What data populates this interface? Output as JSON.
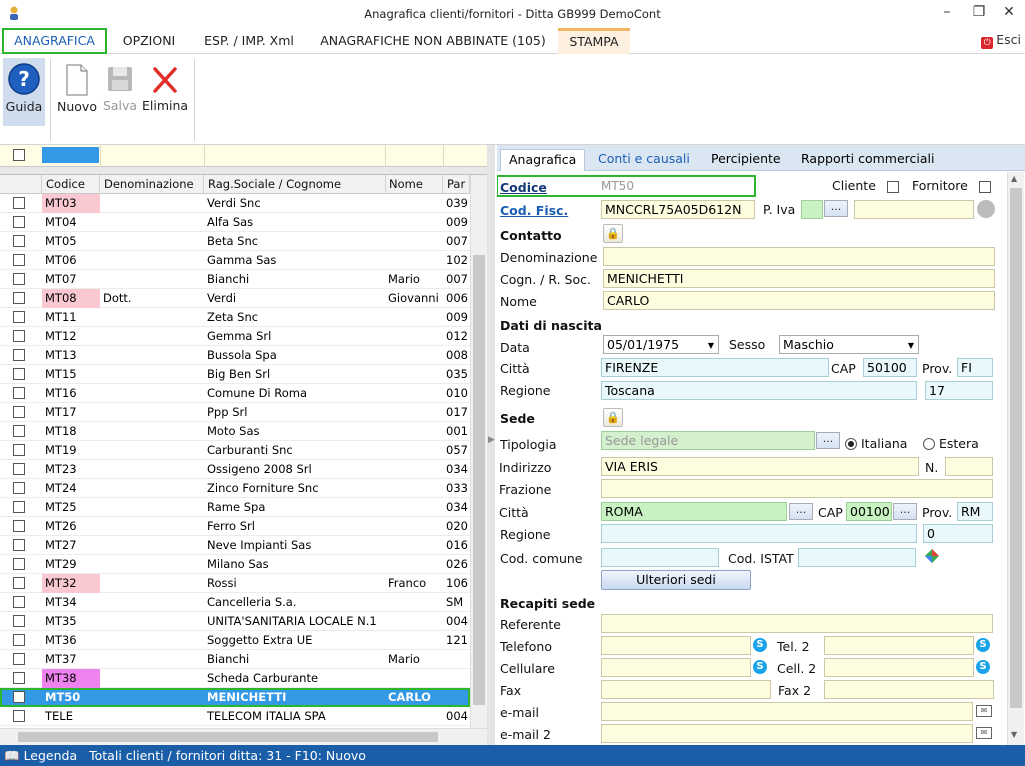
{
  "window": {
    "title": "Anagrafica clienti/fornitori - Ditta GB999 DemoCont"
  },
  "menu": {
    "tabs": [
      "ANAGRAFICA",
      "OPZIONI",
      "ESP. / IMP. Xml",
      "ANAGRAFICHE NON ABBINATE (105)",
      "STAMPA"
    ],
    "exit": "Esci"
  },
  "ribbon": {
    "guida": "Guida",
    "nuovo": "Nuovo",
    "salva": "Salva",
    "elimina": "Elimina"
  },
  "grid": {
    "headers": [
      "Codice",
      "Denominazione",
      "Rag.Sociale / Cognome",
      "Nome",
      "Par"
    ],
    "rows": [
      {
        "code": "MT03",
        "den": "",
        "rag": "Verdi Snc",
        "nome": "",
        "par": "039",
        "color": "#f9c8d0"
      },
      {
        "code": "MT04",
        "den": "",
        "rag": "Alfa Sas",
        "nome": "",
        "par": "009",
        "color": ""
      },
      {
        "code": "MT05",
        "den": "",
        "rag": "Beta Snc",
        "nome": "",
        "par": "007",
        "color": ""
      },
      {
        "code": "MT06",
        "den": "",
        "rag": "Gamma Sas",
        "nome": "",
        "par": "102",
        "color": ""
      },
      {
        "code": "MT07",
        "den": "",
        "rag": "Bianchi",
        "nome": "Mario",
        "par": "007",
        "color": ""
      },
      {
        "code": "MT08",
        "den": "Dott.",
        "rag": "Verdi",
        "nome": "Giovanni",
        "par": "006",
        "color": "#f9c8d0"
      },
      {
        "code": "MT11",
        "den": "",
        "rag": "Zeta Snc",
        "nome": "",
        "par": "009",
        "color": ""
      },
      {
        "code": "MT12",
        "den": "",
        "rag": "Gemma Srl",
        "nome": "",
        "par": "012",
        "color": ""
      },
      {
        "code": "MT13",
        "den": "",
        "rag": "Bussola Spa",
        "nome": "",
        "par": "008",
        "color": ""
      },
      {
        "code": "MT15",
        "den": "",
        "rag": "Big Ben Srl",
        "nome": "",
        "par": "035",
        "color": ""
      },
      {
        "code": "MT16",
        "den": "",
        "rag": "Comune Di Roma",
        "nome": "",
        "par": "010",
        "color": ""
      },
      {
        "code": "MT17",
        "den": "",
        "rag": "Ppp Srl",
        "nome": "",
        "par": "017",
        "color": ""
      },
      {
        "code": "MT18",
        "den": "",
        "rag": "Moto Sas",
        "nome": "",
        "par": "001",
        "color": ""
      },
      {
        "code": "MT19",
        "den": "",
        "rag": "Carburanti Snc",
        "nome": "",
        "par": "057",
        "color": ""
      },
      {
        "code": "MT23",
        "den": "",
        "rag": "Ossigeno 2008 Srl",
        "nome": "",
        "par": "034",
        "color": ""
      },
      {
        "code": "MT24",
        "den": "",
        "rag": "Zinco Forniture Snc",
        "nome": "",
        "par": "033",
        "color": ""
      },
      {
        "code": "MT25",
        "den": "",
        "rag": "Rame Spa",
        "nome": "",
        "par": "034",
        "color": ""
      },
      {
        "code": "MT26",
        "den": "",
        "rag": "Ferro Srl",
        "nome": "",
        "par": "020",
        "color": ""
      },
      {
        "code": "MT27",
        "den": "",
        "rag": "Neve Impianti Sas",
        "nome": "",
        "par": "016",
        "color": ""
      },
      {
        "code": "MT29",
        "den": "",
        "rag": "Milano Sas",
        "nome": "",
        "par": "026",
        "color": ""
      },
      {
        "code": "MT32",
        "den": "",
        "rag": "Rossi",
        "nome": "Franco",
        "par": "106",
        "color": "#f9c8d0"
      },
      {
        "code": "MT34",
        "den": "",
        "rag": "Cancelleria S.a.",
        "nome": "",
        "par": "SM",
        "color": ""
      },
      {
        "code": "MT35",
        "den": "",
        "rag": "UNITA'SANITARIA LOCALE N.1",
        "nome": "",
        "par": "004",
        "color": ""
      },
      {
        "code": "MT36",
        "den": "",
        "rag": "Soggetto Extra UE",
        "nome": "",
        "par": "121",
        "color": ""
      },
      {
        "code": "MT37",
        "den": "",
        "rag": "Bianchi",
        "nome": "Mario",
        "par": "",
        "color": ""
      },
      {
        "code": "MT38",
        "den": "",
        "rag": "Scheda Carburante",
        "nome": "",
        "par": "",
        "color": "#ee82ee"
      },
      {
        "code": "MT50",
        "den": "",
        "rag": "MENICHETTI",
        "nome": "CARLO",
        "par": "",
        "color": "sel"
      },
      {
        "code": "TELE",
        "den": "",
        "rag": "TELECOM ITALIA SPA",
        "nome": "",
        "par": "004",
        "color": ""
      }
    ]
  },
  "detail": {
    "tabs": [
      "Anagrafica",
      "Conti e causali",
      "Percipiente",
      "Rapporti commerciali"
    ],
    "codice_label": "Codice",
    "codice": "MT50",
    "cliente": "Cliente",
    "fornitore": "Fornitore",
    "codfisc_label": "Cod. Fisc.",
    "codfisc": "MNCCRL75A05D612N",
    "piva_label": "P. Iva",
    "contatto": "Contatto",
    "denominazione_label": "Denominazione",
    "denominazione": "",
    "cognome_label": "Cogn. / R. Soc.",
    "cognome": "MENICHETTI",
    "nome_label": "Nome",
    "nome": "CARLO",
    "nascita": "Dati di nascita",
    "data_label": "Data",
    "data": "05/01/1975",
    "sesso_label": "Sesso",
    "sesso": "Maschio",
    "citta_label": "Città",
    "citta": "FIRENZE",
    "cap_label": "CAP",
    "cap": "50100",
    "prov_label": "Prov.",
    "prov": "FI",
    "regione_label": "Regione",
    "regione": "Toscana",
    "regione_code": "17",
    "sede": "Sede",
    "tipologia_label": "Tipologia",
    "tipologia": "Sede legale",
    "italiana": "Italiana",
    "estera": "Estera",
    "indirizzo_label": "Indirizzo",
    "indirizzo": "VIA ERIS",
    "n_label": "N.",
    "frazione_label": "Frazione",
    "sede_citta_label": "Città",
    "sede_citta": "ROMA",
    "sede_cap_label": "CAP",
    "sede_cap": "00100",
    "sede_prov_label": "Prov.",
    "sede_prov": "RM",
    "sede_regione_label": "Regione",
    "sede_regione_code": "0",
    "codcomune_label": "Cod. comune",
    "codistat_label": "Cod. ISTAT",
    "ulteriori": "Ulteriori sedi",
    "recapiti": "Recapiti sede",
    "referente_label": "Referente",
    "telefono_label": "Telefono",
    "tel2_label": "Tel. 2",
    "cellulare_label": "Cellulare",
    "cell2_label": "Cell. 2",
    "fax_label": "Fax",
    "fax2_label": "Fax 2",
    "email_label": "e-mail",
    "email2_label": "e-mail 2"
  },
  "status": {
    "legenda": "Legenda",
    "text": "Totali clienti / fornitori ditta: 31  -  F10: Nuovo"
  }
}
